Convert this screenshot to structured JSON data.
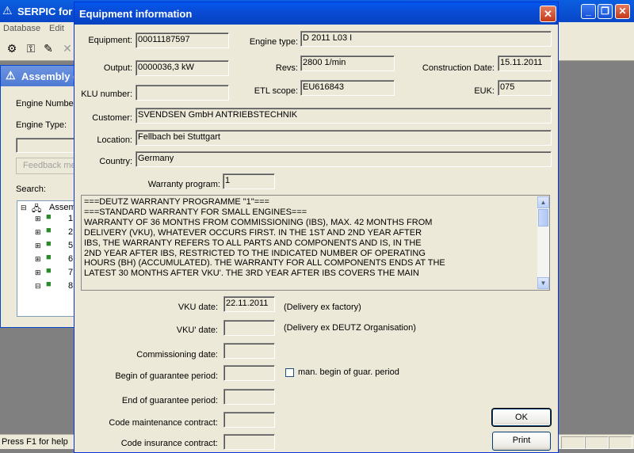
{
  "main_window": {
    "title": "SERPIC for V",
    "menu": [
      "Database",
      "Edit"
    ],
    "toolbar_icons": [
      "stamp-icon",
      "key-icon",
      "wrench-icon",
      "cancel-icon"
    ],
    "controls": [
      "_",
      "❐",
      "✕"
    ],
    "status_text": "Press F1 for help"
  },
  "assembly_window": {
    "title": "Assembly g",
    "engine_number_label": "Engine Number",
    "engine_type_label": "Engine Type:",
    "feedback_button": "Feedback me",
    "search_label": "Search:",
    "tree_root": "Assem",
    "tree_items": [
      "1",
      "2",
      "5",
      "6",
      "7",
      "8"
    ]
  },
  "dialog": {
    "title": "Equipment information",
    "close_glyph": "✕",
    "fields": {
      "equipment_label": "Equipment:",
      "equipment_value": "00011187597",
      "engine_type_label": "Engine type:",
      "engine_type_value": "D 2011 L03 I",
      "output_label": "Output:",
      "output_value": "0000036,3 kW",
      "revs_label": "Revs:",
      "revs_value": "2800 1/min",
      "construction_date_label": "Construction Date:",
      "construction_date_value": "15.11.2011",
      "klu_number_label": "KLU number:",
      "klu_number_value": "",
      "etl_scope_label": "ETL scope:",
      "etl_scope_value": "EU616843",
      "euk_label": "EUK:",
      "euk_value": "075",
      "customer_label": "Customer:",
      "customer_value": "SVENDSEN GmbH ANTRIEBSTECHNIK",
      "location_label": "Location:",
      "location_value": "Fellbach bei Stuttgart",
      "country_label": "Country:",
      "country_value": "Germany",
      "warranty_program_label": "Warranty program:",
      "warranty_program_value": "1"
    },
    "warranty_text": "===DEUTZ WARRANTY PROGRAMME \"1\"===\n===STANDARD WARRANTY FOR SMALL ENGINES===\nWARRANTY OF 36 MONTHS FROM COMMISSIONING (IBS), MAX. 42 MONTHS FROM\nDELIVERY (VKU), WHATEVER OCCURS FIRST. IN THE 1ST AND 2ND YEAR AFTER\nIBS, THE WARRANTY REFERS TO ALL PARTS AND COMPONENTS AND IS, IN THE\n2ND YEAR AFTER IBS, RESTRICTED TO THE INDICATED NUMBER OF OPERATING\nHOURS (BH) (ACCUMULATED). THE WARRANTY FOR ALL COMPONENTS ENDS AT THE\nLATEST 30 MONTHS AFTER VKU'. THE 3RD YEAR AFTER IBS COVERS THE MAIN",
    "dates": {
      "vku_date_label": "VKU date:",
      "vku_date_value": "22.11.2011",
      "vku_date_note": "(Delivery ex factory)",
      "vku2_date_label": "VKU' date:",
      "vku2_date_value": "",
      "vku2_date_note": "(Delivery ex DEUTZ Organisation)",
      "commissioning_label": "Commissioning date:",
      "commissioning_value": "",
      "begin_guarantee_label": "Begin of guarantee period:",
      "begin_guarantee_value": "",
      "man_begin_label": "man. begin of guar. period",
      "end_guarantee_label": "End of guarantee period:",
      "end_guarantee_value": "",
      "code_maintenance_label": "Code maintenance contract:",
      "code_maintenance_value": "",
      "code_insurance_label": "Code insurance contract:",
      "code_insurance_value": ""
    },
    "buttons": {
      "ok": "OK",
      "print": "Print"
    }
  }
}
